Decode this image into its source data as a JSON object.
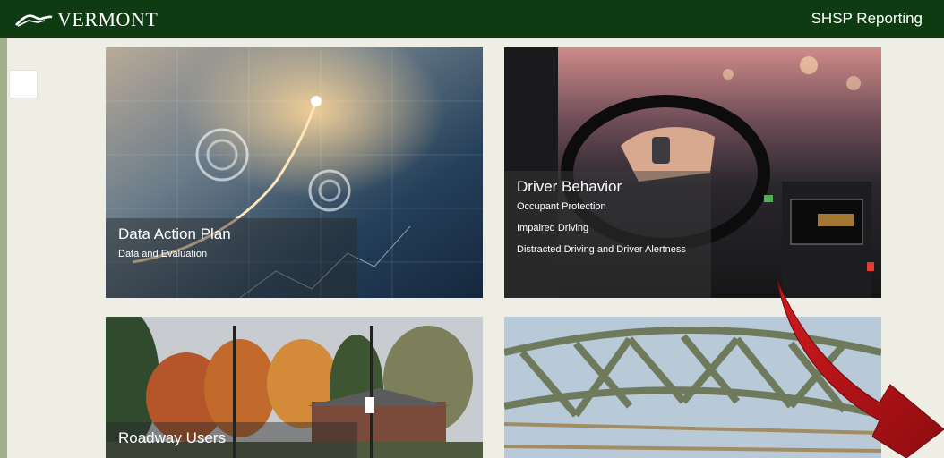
{
  "header": {
    "logo_text": "VERMONT",
    "app_title": "SHSP Reporting"
  },
  "tiles": [
    {
      "title": "Data Action Plan",
      "links": [
        "Data and Evaluation"
      ]
    },
    {
      "title": "Driver Behavior",
      "links": [
        "Occupant Protection",
        "Impaired Driving",
        "Distracted Driving and Driver Alertness"
      ]
    },
    {
      "title": "Roadway Users",
      "links": []
    },
    {
      "title": "",
      "links": []
    }
  ],
  "colors": {
    "header_bg": "#0e3b12",
    "page_bg": "#efeee5",
    "rail": "#9fb08a",
    "arrow": "#b30f14"
  },
  "icons": [
    "vermont-mountain-logo-icon"
  ]
}
